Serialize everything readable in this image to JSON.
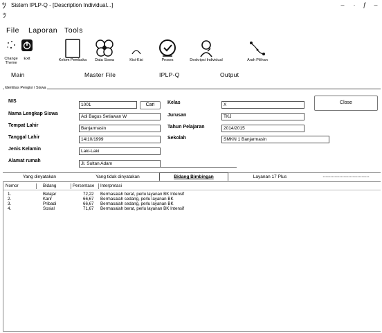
{
  "window": {
    "title": "Sistem IPLP-Q - [Description Individual...]",
    "controls": [
      "‒",
      "·",
      "ƒ",
      "‒"
    ]
  },
  "menu": [
    "File",
    "Laporan",
    "Tools"
  ],
  "toolbar": {
    "tools": [
      {
        "label": "Change\nTheme",
        "icon": "palette-icon"
      },
      {
        "label": "Exit",
        "icon": "power-icon"
      },
      {
        "label": "Kelom Pembaka",
        "icon": "document-icon"
      },
      {
        "label": "Data Siswa",
        "icon": "students-icon"
      },
      {
        "label": "Kisi-Kisi",
        "icon": "arc-icon"
      },
      {
        "label": "Proses",
        "icon": "process-icon"
      },
      {
        "label": "Deskripsi Individual",
        "icon": "person-icon"
      },
      {
        "label": "Arah Pilihan",
        "icon": "path-icon"
      }
    ],
    "groups": [
      "Main",
      "Master File",
      "IPLP-Q",
      "Output"
    ]
  },
  "identity": {
    "legend": "Identitas Pengisi / Siswa",
    "fields": {
      "nis": {
        "label": "NIS",
        "value": "1001"
      },
      "nama": {
        "label": "Nama Lengkap Siswa",
        "value": "Adi Bagus Setiawan W"
      },
      "tempat_lahir": {
        "label": "Tempat Lahir",
        "value": "Banjarmasin"
      },
      "tanggal_lahir": {
        "label": "Tanggal Lahir",
        "value": "14/10/1999"
      },
      "jenis_kelamin": {
        "label": "Jenis Kelamin",
        "value": "Laki-Laki"
      },
      "alamat": {
        "label": "Alamat rumah",
        "value": "Jl. Sultan Adam"
      },
      "kelas": {
        "label": "Kelas",
        "value": "X"
      },
      "jurusan": {
        "label": "Jurusan",
        "value": "TKJ"
      },
      "tahun_pelajaran": {
        "label": "Tahun Pelajaran",
        "value": "2014/2015"
      },
      "sekolah": {
        "label": "Sekolah",
        "value": "SMKN 1 Banjarmasin"
      }
    },
    "cari_button": "Cari",
    "close_button": "Close"
  },
  "tabs": [
    {
      "label": "Yang dinyatakan",
      "active": false
    },
    {
      "label": "Yang tidak dinyatakan",
      "active": false
    },
    {
      "label": "Bidang Bimbingan",
      "active": true
    },
    {
      "label": "Layanan 17 Plus",
      "active": false
    },
    {
      "label": "-------------------------------",
      "active": false
    }
  ],
  "table": {
    "columns": [
      "Nomor",
      "Bidang",
      "Persentase",
      "Interpretasi"
    ],
    "rows": [
      [
        "1.",
        "Belajar",
        "72,22",
        "Bermasalah berat, perlu layanan BK Intensif"
      ],
      [
        "2.",
        "Karir",
        "66,67",
        "Bermasalah sedang, perlu layanan BK"
      ],
      [
        "3.",
        "Pribadi",
        "66,67",
        "Bermasalah sedang, perlu layanan BK"
      ],
      [
        "4.",
        "Sosial",
        "71,67",
        "Bermasalah berat, perlu layanan BK Intensif"
      ]
    ]
  }
}
